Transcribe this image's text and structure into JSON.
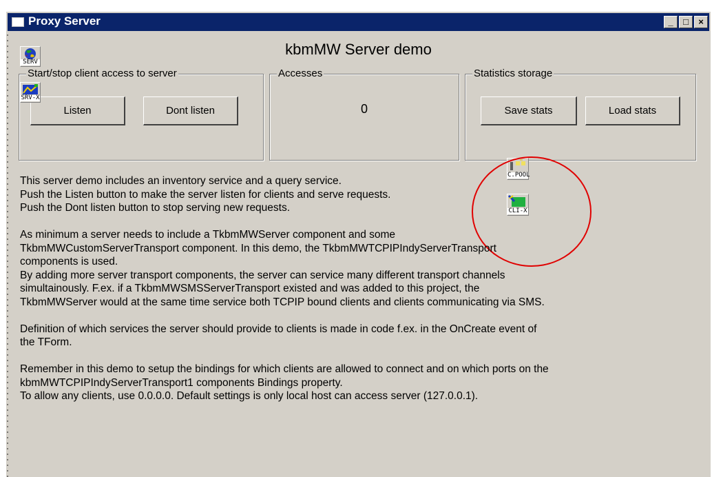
{
  "window": {
    "title": "Proxy Server",
    "controls": {
      "minimize": "_",
      "maximize": "□",
      "close": "×"
    }
  },
  "heading": "kbmMW Server demo",
  "groups": {
    "client_access": {
      "label": "Start/stop client access to server",
      "listen_button": "Listen",
      "dont_listen_button": "Dont listen"
    },
    "accesses": {
      "label": "Accesses",
      "count": "0"
    },
    "statistics": {
      "label": "Statistics storage",
      "save_button": "Save stats",
      "load_button": "Load stats"
    }
  },
  "components": {
    "serv": "SERV",
    "srv_x": "SRV-X",
    "c_pool": "C.POOL",
    "cli_x": "CLI-X"
  },
  "description": [
    "This server demo includes an inventory service and a query service.",
    "Push the Listen button to make the server listen for clients and serve requests.",
    "Push the Dont listen button to stop serving new requests.",
    "",
    "As minimum a server needs to include a TkbmMWServer component and some",
    "TkbmMWCustomServerTransport component. In this demo, the TkbmMWTCPIPIndyServerTransport",
    "components is used.",
    "By adding more server transport components, the server can service many different transport channels",
    "simultainously. F.ex. if a TkbmMWSMSServerTransport existed and was added to this project, the",
    "TkbmMWServer would at the same time service both TCPIP bound clients and clients communicating via SMS.",
    "",
    "Definition of which services the server should provide to clients is made in code f.ex. in the OnCreate event of",
    "the TForm.",
    "",
    "Remember in this demo to setup the bindings for which clients are allowed to connect and on which ports on the",
    "kbmMWTCPIPIndyServerTransport1 components Bindings property.",
    "To allow any clients, use 0.0.0.0. Default settings is only local host can access server (127.0.0.1)."
  ],
  "colors": {
    "titlebar": "#0a246a",
    "face": "#d4d0c8",
    "highlight": "#e00000"
  }
}
